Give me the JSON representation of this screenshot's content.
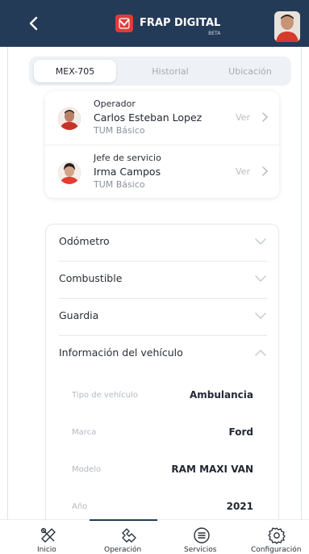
{
  "header": {
    "brand_title": "FRAP DIGITAL",
    "brand_subtitle": "BETA",
    "colors": {
      "bar": "#243b58",
      "brand_mark": "#e23a3a"
    }
  },
  "tabs": [
    {
      "label": "MEX-705",
      "active": true
    },
    {
      "label": "Historial",
      "active": false
    },
    {
      "label": "Ubicación",
      "active": false
    }
  ],
  "crew": [
    {
      "role": "Operador",
      "name": "Carlos Esteban Lopez",
      "level": "TUM Básico",
      "action": "Ver"
    },
    {
      "role": "Jefe de servicio",
      "name": "Irma Campos",
      "level": "TUM Básico",
      "action": "Ver"
    }
  ],
  "sections": [
    {
      "label": "Odómetro",
      "expanded": false,
      "icon": "chevron-down-icon"
    },
    {
      "label": "Combustible",
      "expanded": false,
      "icon": "chevron-down-icon"
    },
    {
      "label": "Guardia",
      "expanded": false,
      "icon": "chevron-down-icon"
    },
    {
      "label": "Información del vehículo",
      "expanded": true,
      "icon": "chevron-up-icon"
    }
  ],
  "vehicle_info": [
    {
      "label": "Tipo de vehículo",
      "value": "Ambulancia"
    },
    {
      "label": "Marca",
      "value": "Ford"
    },
    {
      "label": "Modelo",
      "value": "RAM MAXI VAN"
    },
    {
      "label": "Año",
      "value": "2021"
    }
  ],
  "bottom_nav": [
    {
      "label": "Inicio",
      "icon": "tools-icon",
      "active": false
    },
    {
      "label": "Operación",
      "icon": "operation-icon",
      "active": true
    },
    {
      "label": "Servicios",
      "icon": "list-icon",
      "active": false
    },
    {
      "label": "Configuración",
      "icon": "settings-icon",
      "active": false
    }
  ]
}
